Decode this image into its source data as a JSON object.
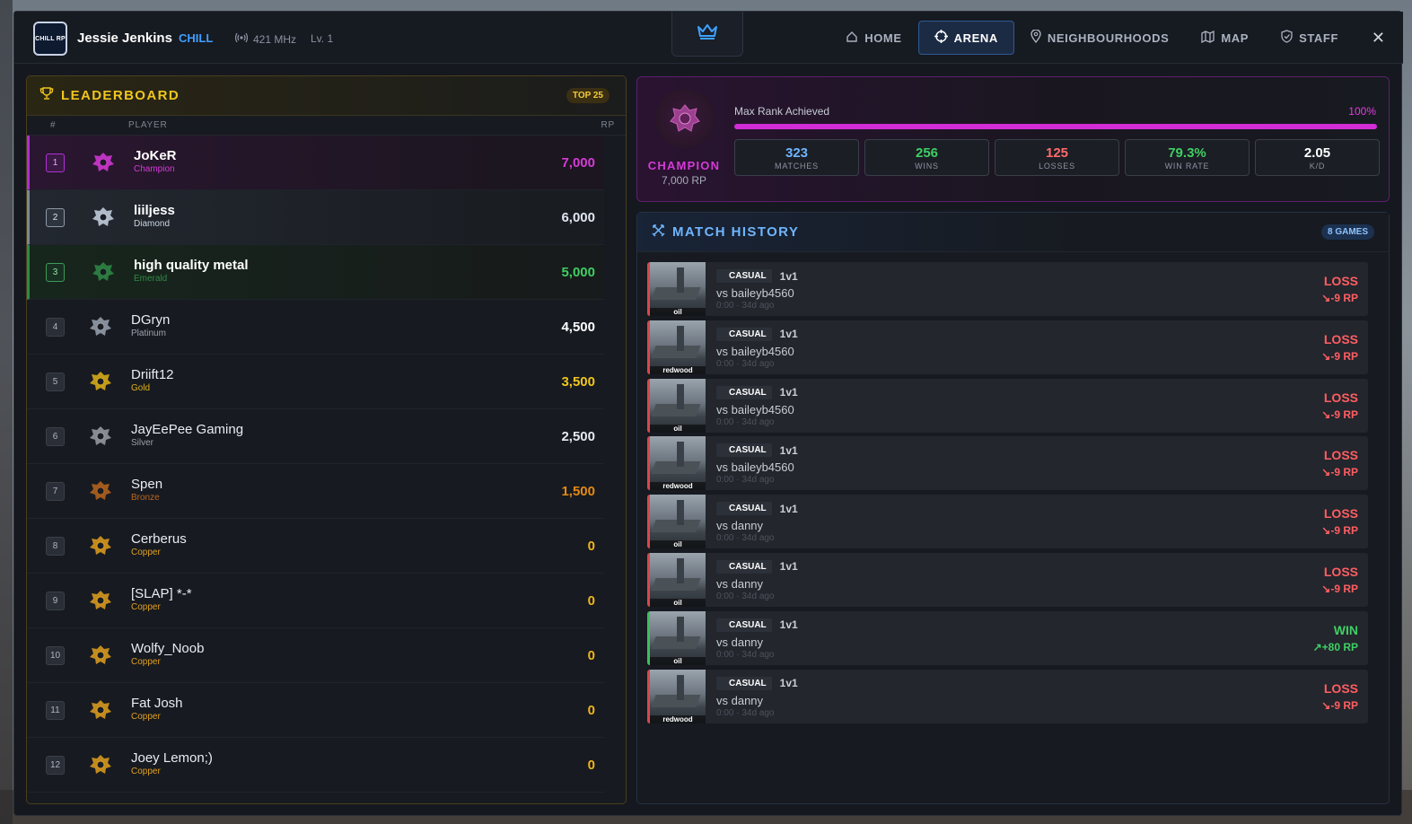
{
  "header": {
    "logo_text": "CHILL RP",
    "user_name": "Jessie Jenkins",
    "user_tag": "CHILL",
    "frequency": "421 MHz",
    "level": "Lv. 1",
    "nav": [
      {
        "label": "HOME",
        "icon": "home-icon"
      },
      {
        "label": "ARENA",
        "icon": "crosshair-icon",
        "active": true
      },
      {
        "label": "NEIGHBOURHOODS",
        "icon": "map-pin-icon"
      },
      {
        "label": "MAP",
        "icon": "map-icon"
      },
      {
        "label": "STAFF",
        "icon": "shield-icon"
      }
    ],
    "close": "✕"
  },
  "leaderboard": {
    "title": "LEADERBOARD",
    "badge": "TOP 25",
    "col_rank": "#",
    "col_player": "PLAYER",
    "col_rp": "RP",
    "rows": [
      {
        "rank": "1",
        "name": "JoKeR",
        "tier": "Champion",
        "rp": "7,000"
      },
      {
        "rank": "2",
        "name": "liiljess",
        "tier": "Diamond",
        "rp": "6,000"
      },
      {
        "rank": "3",
        "name": "high quality metal",
        "tier": "Emerald",
        "rp": "5,000"
      },
      {
        "rank": "4",
        "name": "DGryn",
        "tier": "Platinum",
        "rp": "4,500"
      },
      {
        "rank": "5",
        "name": "Driift12",
        "tier": "Gold",
        "rp": "3,500"
      },
      {
        "rank": "6",
        "name": "JayEePee Gaming",
        "tier": "Silver",
        "rp": "2,500"
      },
      {
        "rank": "7",
        "name": "Spen",
        "tier": "Bronze",
        "rp": "1,500"
      },
      {
        "rank": "8",
        "name": "Cerberus",
        "tier": "Copper",
        "rp": "0"
      },
      {
        "rank": "9",
        "name": "[SLAP] *-*",
        "tier": "Copper",
        "rp": "0"
      },
      {
        "rank": "10",
        "name": "Wolfy_Noob",
        "tier": "Copper",
        "rp": "0"
      },
      {
        "rank": "11",
        "name": "Fat Josh",
        "tier": "Copper",
        "rp": "0"
      },
      {
        "rank": "12",
        "name": "Joey Lemon;)",
        "tier": "Copper",
        "rp": "0"
      }
    ]
  },
  "tier_colors": {
    "Champion": "#d63ad8",
    "Diamond": "#c9d4e2",
    "Emerald": "#2f8a47",
    "Platinum": "#9aa3b1",
    "Gold": "#e0b11a",
    "Silver": "#9aa0a8",
    "Bronze": "#b8661f",
    "Copper": "#e0a020"
  },
  "rp_colors": {
    "Champion": "#d63ad8",
    "Diamond": "#dfe6f0",
    "Emerald": "#3fcf63",
    "Platinum": "#ffffff",
    "Gold": "#f0c61d",
    "Silver": "#e6e9ef",
    "Bronze": "#e58a12",
    "Copper": "#f0b51d"
  },
  "champion": {
    "tier": "CHAMPION",
    "rp": "7,000 RP",
    "progress_label": "Max Rank Achieved",
    "progress_pct": "100%",
    "progress_fraction": 1.0,
    "stats": [
      {
        "value": "323",
        "label": "MATCHES",
        "color": "#6fb5ff"
      },
      {
        "value": "256",
        "label": "WINS",
        "color": "#3fcf63"
      },
      {
        "value": "125",
        "label": "LOSSES",
        "color": "#ff6b6b"
      },
      {
        "value": "79.3%",
        "label": "WIN RATE",
        "color": "#3fcf63"
      },
      {
        "value": "2.05",
        "label": "K/D",
        "color": "#ffffff"
      }
    ]
  },
  "match_history": {
    "title": "MATCH HISTORY",
    "badge": "8 GAMES",
    "matches": [
      {
        "map": "oil",
        "type": "CASUAL",
        "format": "1v1",
        "vs": "vs baileyb4560",
        "meta": "0:00 · 34d ago",
        "result": "LOSS",
        "delta": "↘-9 RP"
      },
      {
        "map": "redwood",
        "type": "CASUAL",
        "format": "1v1",
        "vs": "vs baileyb4560",
        "meta": "0:00 · 34d ago",
        "result": "LOSS",
        "delta": "↘-9 RP"
      },
      {
        "map": "oil",
        "type": "CASUAL",
        "format": "1v1",
        "vs": "vs baileyb4560",
        "meta": "0:00 · 34d ago",
        "result": "LOSS",
        "delta": "↘-9 RP"
      },
      {
        "map": "redwood",
        "type": "CASUAL",
        "format": "1v1",
        "vs": "vs baileyb4560",
        "meta": "0:00 · 34d ago",
        "result": "LOSS",
        "delta": "↘-9 RP"
      },
      {
        "map": "oil",
        "type": "CASUAL",
        "format": "1v1",
        "vs": "vs danny",
        "meta": "0:00 · 34d ago",
        "result": "LOSS",
        "delta": "↘-9 RP"
      },
      {
        "map": "oil",
        "type": "CASUAL",
        "format": "1v1",
        "vs": "vs danny",
        "meta": "0:00 · 34d ago",
        "result": "LOSS",
        "delta": "↘-9 RP"
      },
      {
        "map": "oil",
        "type": "CASUAL",
        "format": "1v1",
        "vs": "vs danny",
        "meta": "0:00 · 34d ago",
        "result": "WIN",
        "delta": "↗+80 RP"
      },
      {
        "map": "redwood",
        "type": "CASUAL",
        "format": "1v1",
        "vs": "vs danny",
        "meta": "0:00 · 34d ago",
        "result": "LOSS",
        "delta": "↘-9 RP"
      }
    ]
  }
}
